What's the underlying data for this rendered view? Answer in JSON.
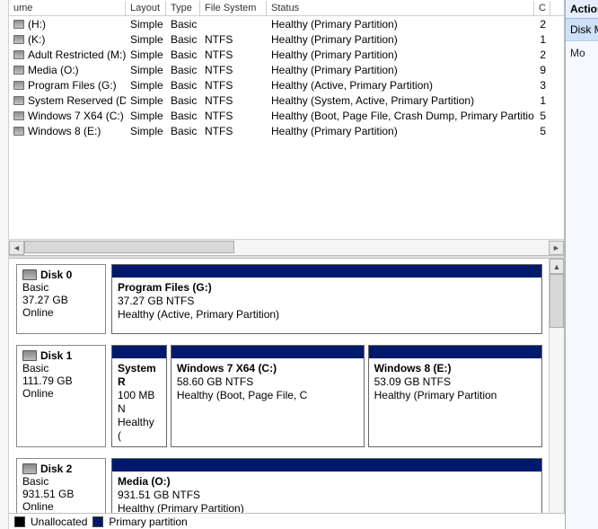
{
  "headers": {
    "volume": "ume",
    "layout": "Layout",
    "type": "Type",
    "fs": "File System",
    "status": "Status",
    "extra": "C"
  },
  "volumes": [
    {
      "name": "(H:)",
      "layout": "Simple",
      "type": "Basic",
      "fs": "",
      "status": "Healthy (Primary Partition)",
      "extra": "2"
    },
    {
      "name": "(K:)",
      "layout": "Simple",
      "type": "Basic",
      "fs": "NTFS",
      "status": "Healthy (Primary Partition)",
      "extra": "1"
    },
    {
      "name": "Adult Restricted (M:)",
      "layout": "Simple",
      "type": "Basic",
      "fs": "NTFS",
      "status": "Healthy (Primary Partition)",
      "extra": "2"
    },
    {
      "name": "Media (O:)",
      "layout": "Simple",
      "type": "Basic",
      "fs": "NTFS",
      "status": "Healthy (Primary Partition)",
      "extra": "9"
    },
    {
      "name": "Program Files (G:)",
      "layout": "Simple",
      "type": "Basic",
      "fs": "NTFS",
      "status": "Healthy (Active, Primary Partition)",
      "extra": "3"
    },
    {
      "name": "System Reserved (D:)",
      "layout": "Simple",
      "type": "Basic",
      "fs": "NTFS",
      "status": "Healthy (System, Active, Primary Partition)",
      "extra": "1"
    },
    {
      "name": "Windows 7 X64 (C:)",
      "layout": "Simple",
      "type": "Basic",
      "fs": "NTFS",
      "status": "Healthy (Boot, Page File, Crash Dump, Primary Partition)",
      "extra": "5"
    },
    {
      "name": "Windows 8 (E:)",
      "layout": "Simple",
      "type": "Basic",
      "fs": "NTFS",
      "status": "Healthy (Primary Partition)",
      "extra": "5"
    }
  ],
  "disks": [
    {
      "name": "Disk 0",
      "type": "Basic",
      "size": "37.27 GB",
      "status": "Online",
      "partitions": [
        {
          "name": "Program Files  (G:)",
          "size": "37.27 GB NTFS",
          "status": "Healthy (Active, Primary Partition)",
          "flex": "1"
        }
      ]
    },
    {
      "name": "Disk 1",
      "type": "Basic",
      "size": "111.79 GB",
      "status": "Online",
      "partitions": [
        {
          "name": "System R",
          "size": "100 MB N",
          "status": "Healthy (",
          "flex": "0.14"
        },
        {
          "name": "Windows 7 X64  (C:)",
          "size": "58.60 GB NTFS",
          "status": "Healthy (Boot, Page File, C",
          "flex": "0.5"
        },
        {
          "name": "Windows 8  (E:)",
          "size": "53.09 GB NTFS",
          "status": "Healthy (Primary Partition",
          "flex": "0.45"
        }
      ]
    },
    {
      "name": "Disk 2",
      "type": "Basic",
      "size": "931.51 GB",
      "status": "Online",
      "partitions": [
        {
          "name": "Media  (O:)",
          "size": "931.51 GB NTFS",
          "status": "Healthy (Primary Partition)",
          "flex": "1"
        }
      ]
    }
  ],
  "legend": {
    "unallocated": "Unallocated",
    "primary": "Primary partition"
  },
  "actions": {
    "header": "Actions",
    "item1": "Disk Ma",
    "item2": "Mo"
  }
}
